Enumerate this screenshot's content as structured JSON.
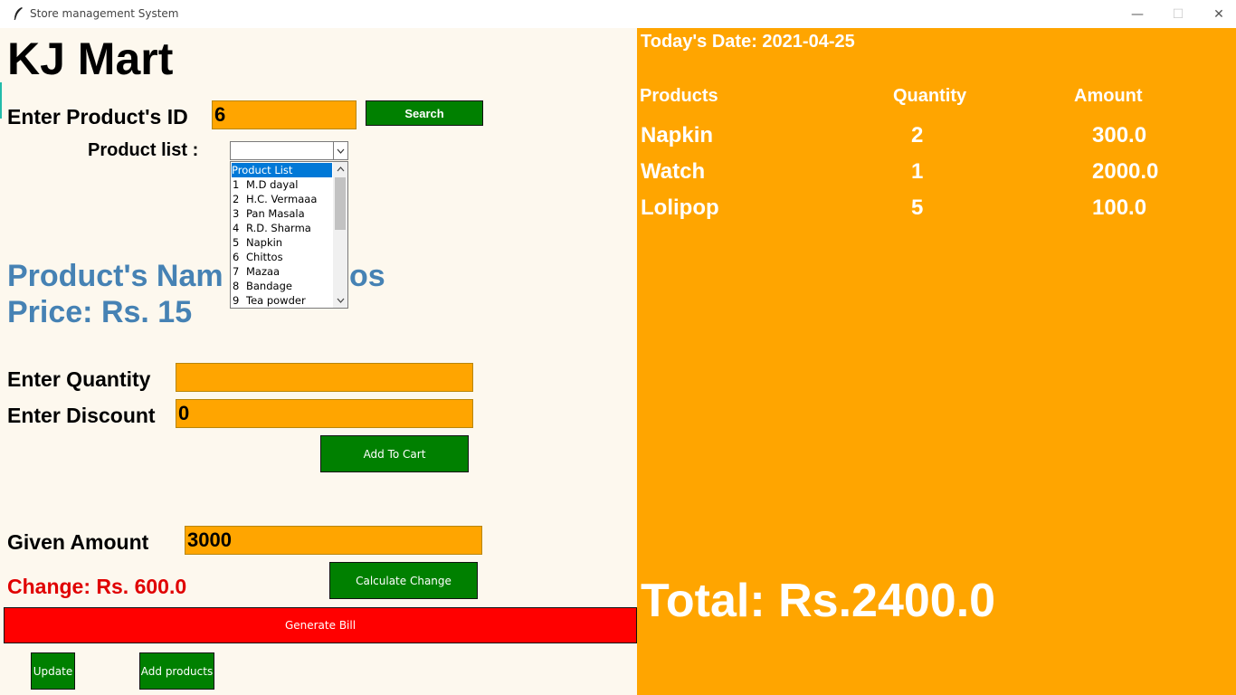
{
  "window": {
    "title": "Store management System",
    "minimize": "—",
    "maximize": "☐",
    "close": "✕"
  },
  "brand": "KJ Mart",
  "search": {
    "label": "Enter Product's ID",
    "value": "6",
    "button": "Search"
  },
  "product_list": {
    "label": "Product list :",
    "selected": "",
    "options": [
      {
        "num": "",
        "name": "Product List"
      },
      {
        "num": "1",
        "name": "M.D dayal"
      },
      {
        "num": "2",
        "name": "H.C. Vermaaa"
      },
      {
        "num": "3",
        "name": "Pan Masala"
      },
      {
        "num": "4",
        "name": "R.D. Sharma"
      },
      {
        "num": "5",
        "name": "Napkin"
      },
      {
        "num": "6",
        "name": "Chittos"
      },
      {
        "num": "7",
        "name": "Mazaa"
      },
      {
        "num": "8",
        "name": "Bandage"
      },
      {
        "num": "9",
        "name": "Tea powder"
      }
    ]
  },
  "product": {
    "name_visible": "Product's Nam",
    "name_tail": "os",
    "price": "Price: Rs. 15"
  },
  "quantity": {
    "label": "Enter Quantity",
    "value": ""
  },
  "discount": {
    "label": "Enter Discount",
    "value": "0"
  },
  "add_to_cart": "Add To Cart",
  "given_amount": {
    "label": "Given Amount",
    "value": "3000"
  },
  "calculate_change": "Calculate Change",
  "change": "Change: Rs. 600.0",
  "generate_bill": "Generate Bill",
  "update": "Update",
  "add_products": "Add products",
  "cart": {
    "date": "Today's Date: 2021-04-25",
    "headers": {
      "products": "Products",
      "quantity": "Quantity",
      "amount": "Amount"
    },
    "rows": [
      {
        "product": "Napkin",
        "qty": "2",
        "amount": "300.0"
      },
      {
        "product": "Watch",
        "qty": "1",
        "amount": "2000.0"
      },
      {
        "product": "Lolipop",
        "qty": "5",
        "amount": "100.0"
      }
    ],
    "total": "Total: Rs.2400.0"
  },
  "colors": {
    "accent": "#ffa500",
    "button": "#008000",
    "bill": "#ff0000",
    "product_text": "#4682b4",
    "change_text": "#e00000",
    "background": "#fdf8ee"
  }
}
